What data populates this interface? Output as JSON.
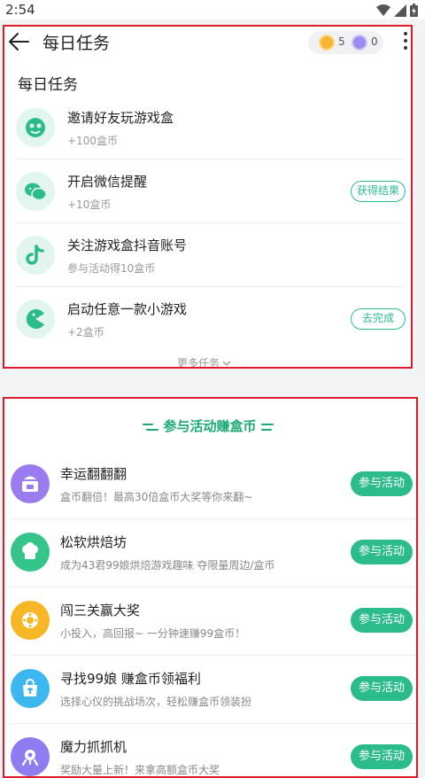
{
  "status": {
    "time": "2:54"
  },
  "header": {
    "title": "每日任务",
    "gold_coins": "5",
    "silver_coins": "0"
  },
  "daily": {
    "section_title": "每日任务",
    "tasks": [
      {
        "icon": "gamepad-icon",
        "name": "邀请好友玩游戏盒",
        "reward": "+100盒币",
        "button": ""
      },
      {
        "icon": "wechat-icon",
        "name": "开启微信提醒",
        "reward": "+10盒币",
        "button": "获得结果"
      },
      {
        "icon": "tiktok-icon",
        "name": "关注游戏盒抖音账号",
        "reward": "参与活动得10盒币",
        "button": ""
      },
      {
        "icon": "pacman-icon",
        "name": "启动任意一款小游戏",
        "reward": "+2盒币",
        "button": "去完成"
      }
    ],
    "more_label": "更多任务"
  },
  "events": {
    "section_title": "参与活动赚盒币",
    "items": [
      {
        "icon": "gift-box-icon",
        "color": "#9b7cf0",
        "name": "幸运翻翻翻",
        "desc": "盒币翻倍！最高30倍盒币大奖等你来翻~",
        "button": "参与活动"
      },
      {
        "icon": "chef-hat-icon",
        "color": "#35c58a",
        "name": "松软烘焙坊",
        "desc": "成为43君99娘烘焙游戏趣味 夺限量周边/盒币",
        "button": "参与活动"
      },
      {
        "icon": "badge-icon",
        "color": "#f6b626",
        "name": "闯三关赢大奖",
        "desc": "小投入，高回报~ 一分钟速赚99盒币！",
        "button": "参与活动"
      },
      {
        "icon": "shop-bag-icon",
        "color": "#3cb7ef",
        "name": "寻找99娘 赚盒币领福利",
        "desc": "选择心仪的挑战场次，轻松赚盒币领装扮",
        "button": "参与活动"
      },
      {
        "icon": "claw-machine-icon",
        "color": "#8f7cf0",
        "name": "魔力抓抓机",
        "desc": "奖励大量上新！来拿高额盒币大奖",
        "button": "参与活动"
      }
    ]
  },
  "colors": {
    "accent": "#2cbc8b",
    "highlight_box": "#e11b2a"
  }
}
